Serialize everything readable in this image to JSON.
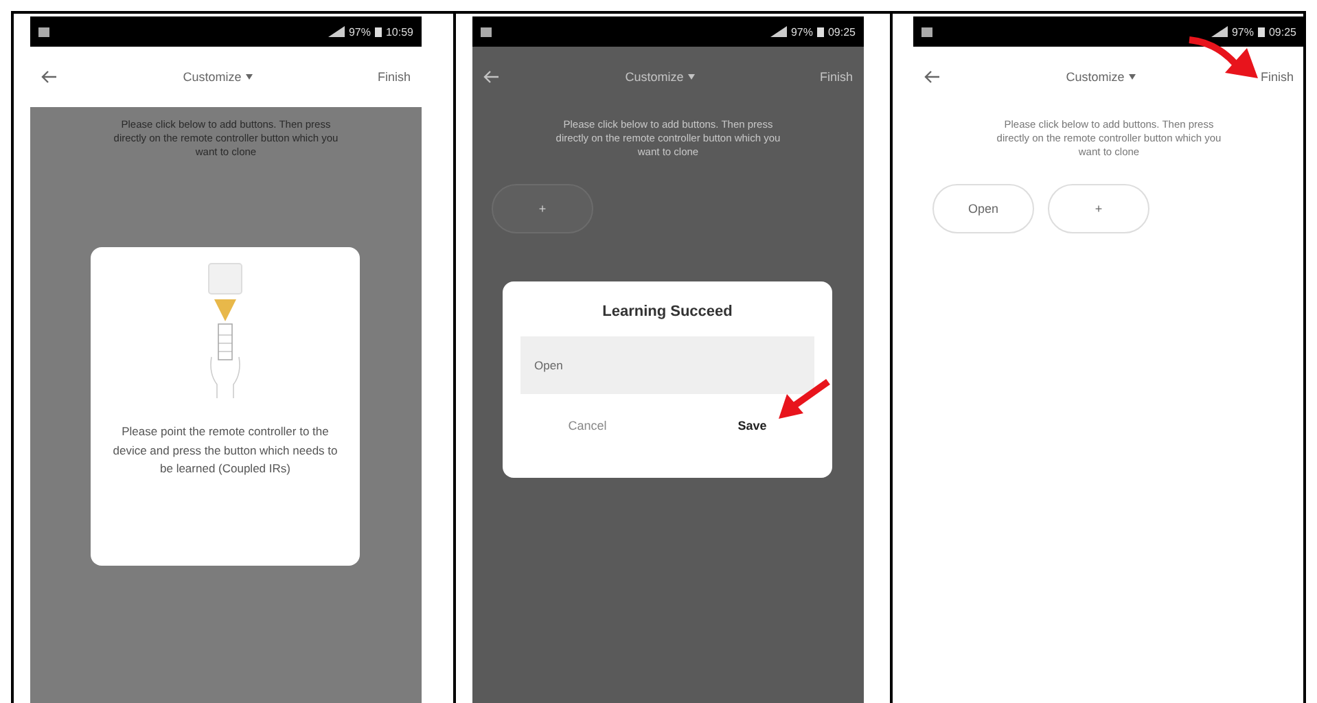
{
  "screens": [
    {
      "status_bar": {
        "battery": "97%",
        "time": "10:59"
      },
      "header": {
        "title": "Customize",
        "action": "Finish",
        "dimmed": false,
        "action_highlighted": false
      },
      "instructions": "Please click below to add buttons. Then press directly on the remote controller button which you want to clone",
      "body_dimmed": true,
      "dialog": {
        "kind": "pointing",
        "text": "Please point the remote controller to the device and press the button which needs to be learned (Coupled IRs)"
      }
    },
    {
      "status_bar": {
        "battery": "97%",
        "time": "09:25"
      },
      "header": {
        "title": "Customize",
        "action": "Finish",
        "dimmed": true,
        "action_highlighted": false
      },
      "instructions": "Please click below to add buttons. Then press directly on the remote controller button which you want to clone",
      "body_dimmed": true,
      "buttons": [
        {
          "label": "+"
        }
      ],
      "dialog": {
        "kind": "naming",
        "title": "Learning Succeed",
        "value": "Open",
        "cancel": "Cancel",
        "save": "Save",
        "save_highlighted": true
      }
    },
    {
      "status_bar": {
        "battery": "97%",
        "time": "09:25"
      },
      "header": {
        "title": "Customize",
        "action": "Finish",
        "dimmed": false,
        "action_highlighted": true
      },
      "instructions": "Please click below to add buttons. Then press directly on the remote controller button which you want to clone",
      "body_dimmed": false,
      "buttons": [
        {
          "label": "Open"
        },
        {
          "label": "+"
        }
      ]
    }
  ]
}
